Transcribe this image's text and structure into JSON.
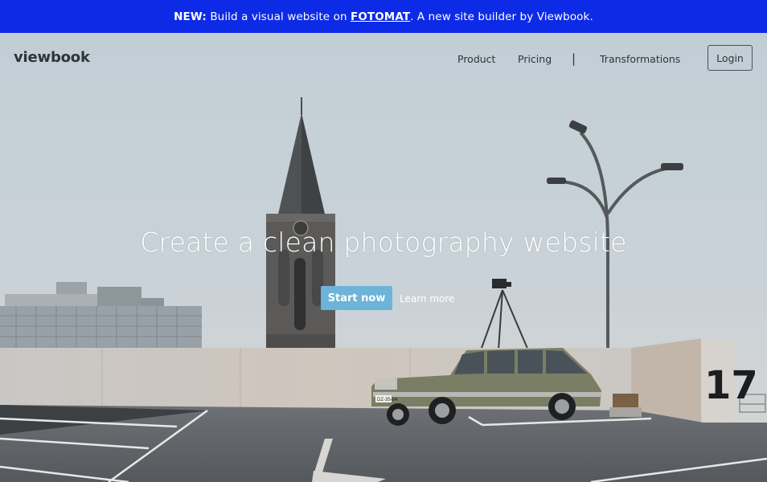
{
  "announcement": {
    "prefix": "NEW:",
    "text_before_link": " Build a visual website on ",
    "link": "FOTOMAT",
    "text_after_link": ". A new site builder by Viewbook."
  },
  "nav": {
    "brand": "viewbook",
    "links": [
      "Product",
      "Pricing",
      "Transformations"
    ],
    "separator": "|",
    "login": "Login"
  },
  "hero": {
    "headline": "Create a clean photography website",
    "primary_cta": "Start now",
    "secondary_cta": "Learn more",
    "wall_number": "17",
    "car_plate": "DZ-35-84"
  },
  "colors": {
    "announcement_bg": "#0d2be6",
    "cta_bg": "#6cb4d8",
    "nav_text": "#2f3438"
  }
}
